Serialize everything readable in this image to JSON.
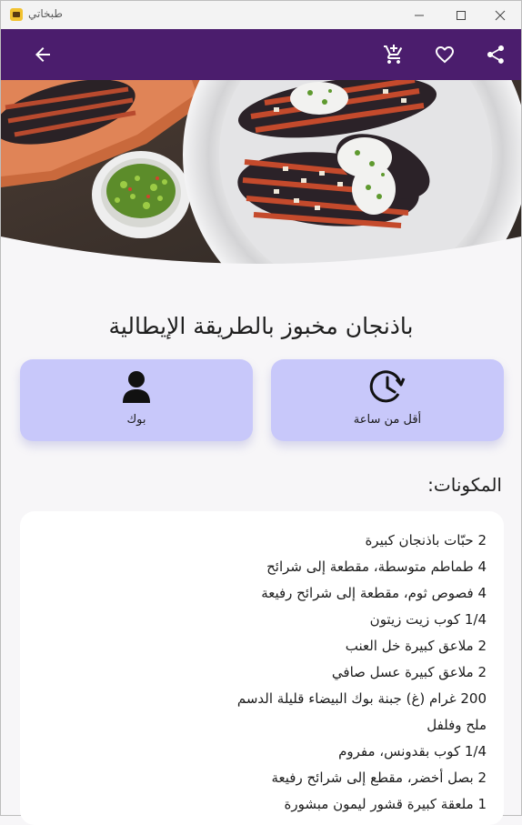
{
  "window": {
    "title": "طبخاتي"
  },
  "appbar": {
    "back_icon": "arrow-left-icon",
    "cart_icon": "add-to-cart-icon",
    "favorite_icon": "heart-outline-icon",
    "share_icon": "share-icon"
  },
  "recipe": {
    "title": "باذنجان مخبوز بالطريقة الإيطالية",
    "time_label": "أقل من ساعة",
    "serves_label": "بوك",
    "ingredients_heading": "المكونات:",
    "ingredients": [
      "2 حبّات باذنجان كبيرة",
      "4 طماطم متوسطة، مقطعة إلى شرائح",
      "4 فصوص ثوم، مقطعة إلى شرائح رفيعة",
      "1/4 كوب زيت زيتون",
      "2 ملاعق كبيرة خل العنب",
      "2 ملاعق كبيرة عسل صافي",
      "200 غرام (غ) جبنة بوك البيضاء قليلة الدسم",
      "ملح وفلفل",
      "1/4 كوب بقدونس، مفروم",
      "2 بصل أخضر، مقطع إلى شرائح رفيعة",
      "1 ملعقة كبيرة قشور ليمون مبشورة"
    ]
  },
  "colors": {
    "appbar": "#4b1d6d",
    "card": "#c8c8fa",
    "background": "#f7f6f8"
  }
}
